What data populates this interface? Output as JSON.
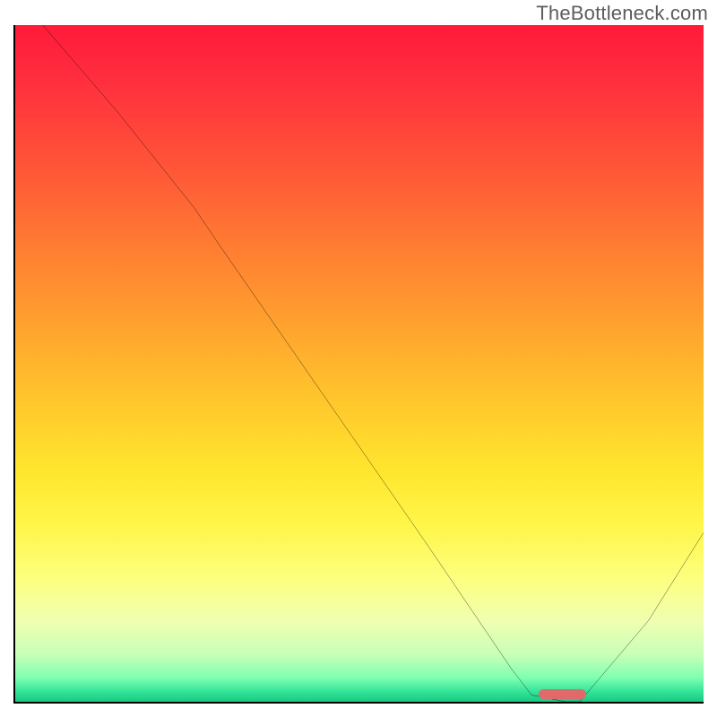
{
  "watermark": "TheBottleneck.com",
  "chart_data": {
    "type": "line",
    "title": "",
    "xlabel": "",
    "ylabel": "",
    "xlim": [
      0,
      100
    ],
    "ylim": [
      0,
      100
    ],
    "grid": false,
    "background": "vertical-gradient red→yellow→green",
    "series": [
      {
        "name": "bottleneck-curve",
        "color": "#000000",
        "x": [
          4,
          15,
          26,
          30,
          45,
          60,
          72,
          75,
          80,
          82,
          92,
          100
        ],
        "y": [
          100,
          87,
          73,
          67,
          45,
          23,
          5,
          1,
          0,
          0,
          12,
          25
        ]
      }
    ],
    "annotations": [
      {
        "name": "optimal-marker",
        "type": "pill",
        "color": "#e06a6a",
        "x_start": 76,
        "x_end": 83,
        "y": 0.4
      }
    ],
    "legend": false
  }
}
